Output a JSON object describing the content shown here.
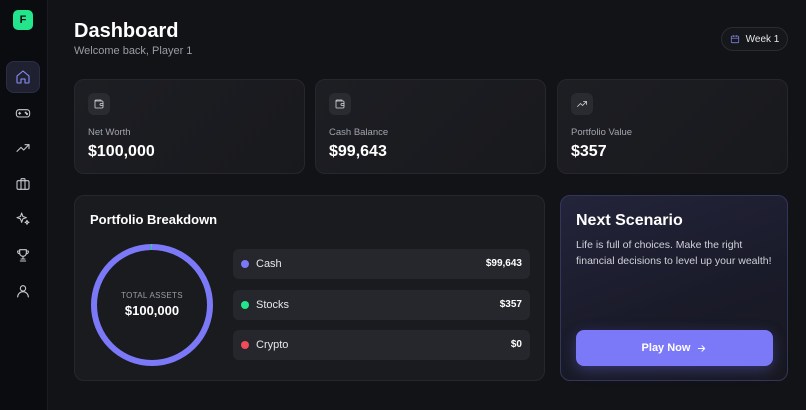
{
  "app": {
    "logo_letter": "F"
  },
  "sidebar": {
    "items": [
      {
        "icon": "home-icon",
        "active": true
      },
      {
        "icon": "gamepad-icon",
        "active": false
      },
      {
        "icon": "trending-up-icon",
        "active": false
      },
      {
        "icon": "briefcase-icon",
        "active": false
      },
      {
        "icon": "sparkles-icon",
        "active": false
      },
      {
        "icon": "trophy-icon",
        "active": false
      },
      {
        "icon": "user-icon",
        "active": false
      }
    ]
  },
  "header": {
    "title": "Dashboard",
    "subtitle": "Welcome back, Player 1",
    "week_label": "Week 1"
  },
  "stats": [
    {
      "label": "Net Worth",
      "value": "$100,000",
      "icon": "wallet-icon"
    },
    {
      "label": "Cash Balance",
      "value": "$99,643",
      "icon": "wallet-icon"
    },
    {
      "label": "Portfolio Value",
      "value": "$357",
      "icon": "trending-up-icon"
    }
  ],
  "breakdown": {
    "title": "Portfolio Breakdown",
    "total_label": "TOTAL ASSETS",
    "total_value": "$100,000",
    "assets": [
      {
        "name": "Cash",
        "amount": "$99,643",
        "value": 99643,
        "color": "#7b79f7"
      },
      {
        "name": "Stocks",
        "amount": "$357",
        "value": 357,
        "color": "#22e58c"
      },
      {
        "name": "Crypto",
        "amount": "$0",
        "value": 0,
        "color": "#ef4b5a"
      }
    ]
  },
  "scenario": {
    "title": "Next Scenario",
    "text": "Life is full of choices. Make the right financial decisions to level up your wealth!",
    "button_label": "Play Now"
  },
  "colors": {
    "accent": "#7b79f7",
    "green": "#22e58c",
    "red": "#ef4b5a",
    "background": "#121317"
  }
}
